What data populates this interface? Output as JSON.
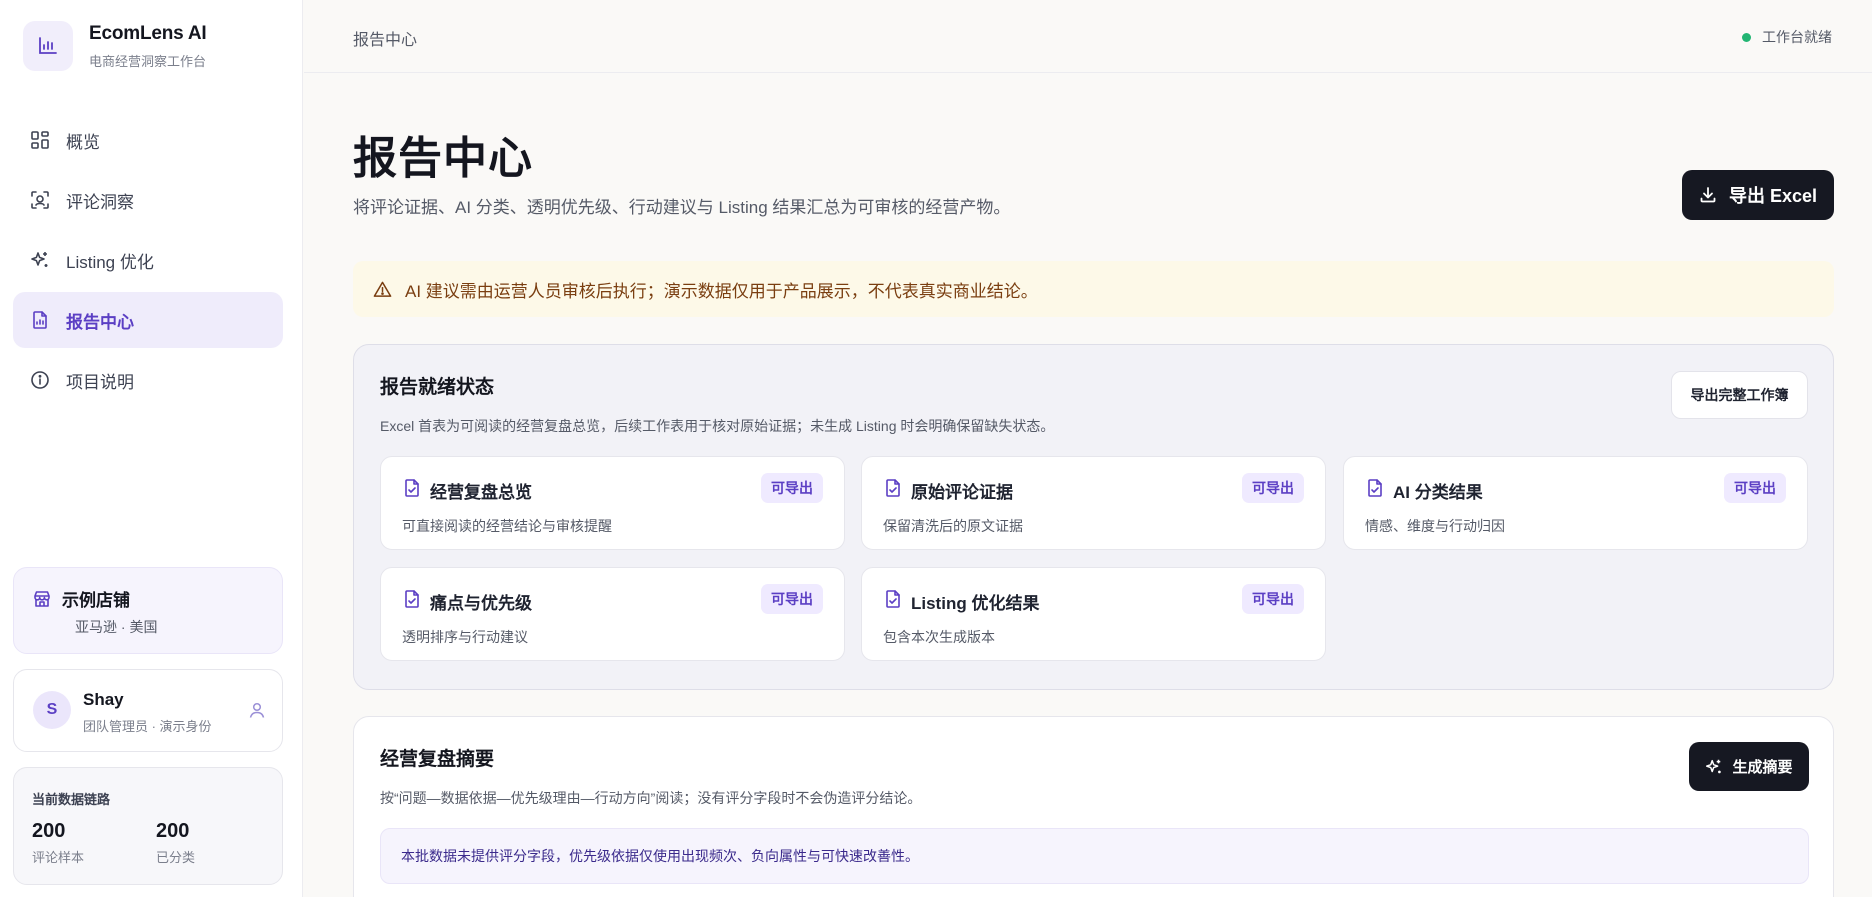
{
  "brand": {
    "name": "EcomLens AI",
    "subtitle": "电商经营洞察工作台"
  },
  "nav": [
    {
      "label": "概览",
      "icon": "grid-icon"
    },
    {
      "label": "评论洞察",
      "icon": "scan-face-icon"
    },
    {
      "label": "Listing 优化",
      "icon": "sparkles-icon"
    },
    {
      "label": "报告中心",
      "icon": "report-file-icon",
      "active": true
    },
    {
      "label": "项目说明",
      "icon": "info-icon"
    }
  ],
  "store": {
    "name": "示例店铺",
    "meta": "亚马逊 · 美国"
  },
  "user": {
    "initial": "S",
    "name": "Shay",
    "role": "团队管理员 · 演示身份"
  },
  "data_link": {
    "title": "当前数据链路",
    "stats": [
      {
        "value": "200",
        "label": "评论样本"
      },
      {
        "value": "200",
        "label": "已分类"
      }
    ]
  },
  "topbar": {
    "breadcrumb": "报告中心",
    "status": "工作台就绪",
    "status_color": "#22b573"
  },
  "page": {
    "title": "报告中心",
    "subtitle": "将评论证据、AI 分类、透明优先级、行动建议与 Listing 结果汇总为可审核的经营产物。",
    "export_label": "导出 Excel"
  },
  "warning": {
    "text": "AI 建议需由运营人员审核后执行；演示数据仅用于产品展示，不代表真实商业结论。"
  },
  "ready": {
    "title": "报告就绪状态",
    "desc": "Excel 首表为可阅读的经营复盘总览，后续工作表用于核对原始证据；未生成 Listing 时会明确保留缺失状态。",
    "action_label": "导出完整工作簿",
    "sheets": [
      {
        "name": "经营复盘总览",
        "desc": "可直接阅读的经营结论与审核提醒",
        "badge": "可导出"
      },
      {
        "name": "原始评论证据",
        "desc": "保留清洗后的原文证据",
        "badge": "可导出"
      },
      {
        "name": "AI 分类结果",
        "desc": "情感、维度与行动归因",
        "badge": "可导出"
      },
      {
        "name": "痛点与优先级",
        "desc": "透明排序与行动建议",
        "badge": "可导出"
      },
      {
        "name": "Listing 优化结果",
        "desc": "包含本次生成版本",
        "badge": "可导出"
      }
    ]
  },
  "summary": {
    "title": "经营复盘摘要",
    "desc": "按“问题—数据依据—优先级理由—行动方向”阅读；没有评分字段时不会伪造评分结论。",
    "action_label": "生成摘要",
    "note": "本批数据未提供评分字段，优先级依据仅使用出现频次、负向属性与可快速改善性。"
  },
  "colors": {
    "accent": "#5b3fc4",
    "dark": "#161822",
    "warning_bg": "#fdf9e8"
  }
}
